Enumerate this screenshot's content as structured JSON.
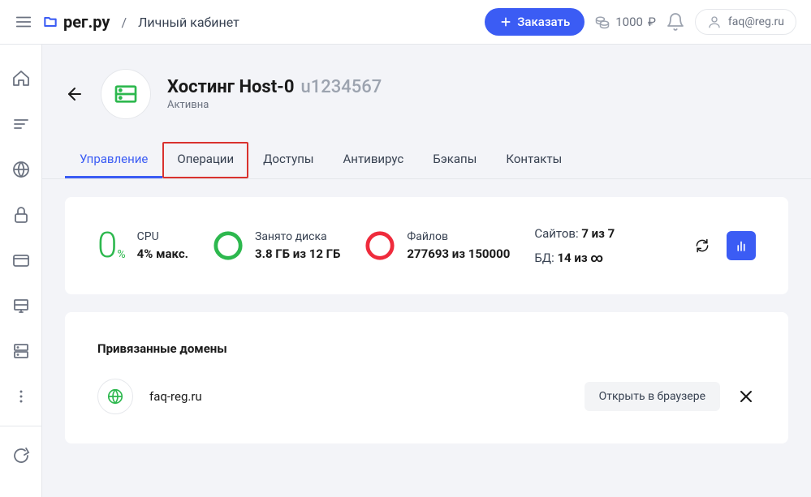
{
  "topbar": {
    "logo_text": "рег.ру",
    "breadcrumb": "Личный кабинет",
    "order_label": "Заказать",
    "balance_value": "1000",
    "balance_currency": "₽",
    "user_email": "faq@reg.ru"
  },
  "page": {
    "title": "Хостинг Host-0",
    "title_id": "u1234567",
    "status": "Активна"
  },
  "tabs": [
    {
      "label": "Управление",
      "active": true
    },
    {
      "label": "Операции",
      "highlighted": true
    },
    {
      "label": "Доступы"
    },
    {
      "label": "Антивирус"
    },
    {
      "label": "Бэкапы"
    },
    {
      "label": "Контакты"
    }
  ],
  "stats": {
    "cpu_label": "CPU",
    "cpu_value": "4% макс.",
    "cpu_number": "0",
    "cpu_suffix": "%",
    "disk_label": "Занято диска",
    "disk_value": "3.8 ГБ из 12 ГБ",
    "files_label": "Файлов",
    "files_value": "277693 из 150000",
    "sites_label": "Сайтов:",
    "sites_value": "7 из 7",
    "db_label": "БД:",
    "db_value": "14 из ∞"
  },
  "domains_section": {
    "title": "Привязанные домены",
    "items": [
      {
        "name": "faq-reg.ru",
        "open_label": "Открыть в браузере"
      }
    ]
  }
}
